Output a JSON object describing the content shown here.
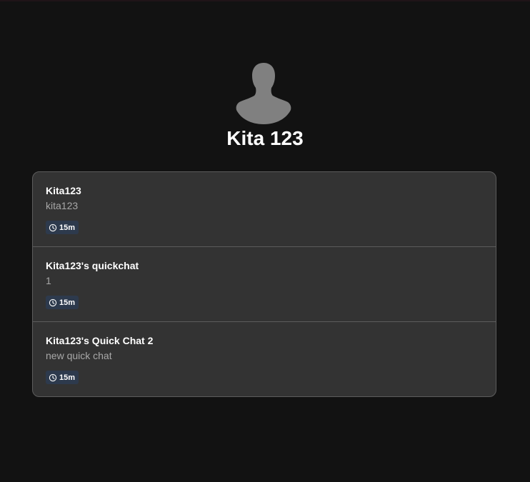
{
  "profile": {
    "name": "Kita 123",
    "avatar_icon": "user-silhouette-icon"
  },
  "chats": [
    {
      "title": "Kita123",
      "subtitle": "kita123",
      "duration": "15m"
    },
    {
      "title": "Kita123's quickchat",
      "subtitle": "1",
      "duration": "15m"
    },
    {
      "title": "Kita123's Quick Chat 2",
      "subtitle": "new quick chat",
      "duration": "15m"
    }
  ],
  "colors": {
    "background": "#121212",
    "card": "#333333",
    "badge": "#2d3a4d",
    "avatar": "#808080"
  }
}
